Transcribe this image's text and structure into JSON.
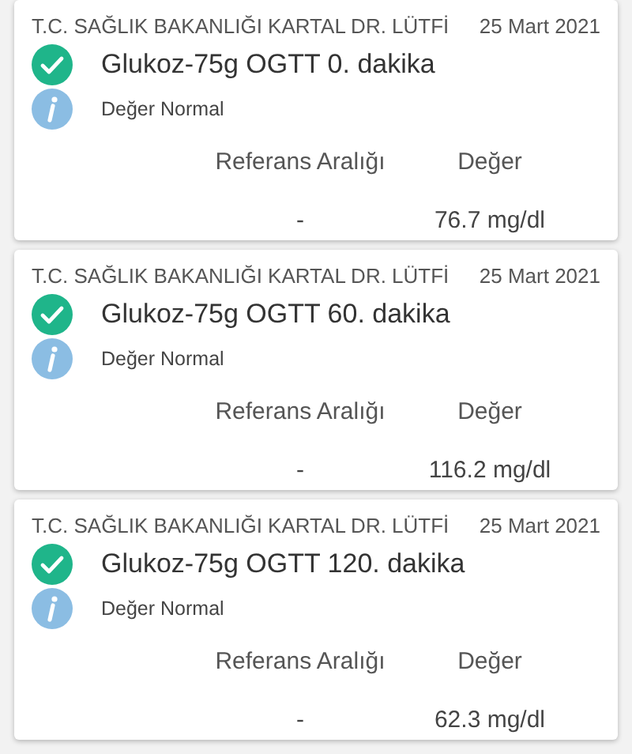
{
  "results": [
    {
      "institution": "T.C. SAĞLIK BAKANLIĞI  KARTAL DR. LÜTFİ",
      "date": "25 Mart 2021",
      "test": "Glukoz-75g OGTT 0. dakika",
      "ok": true,
      "note": "Değer Normal",
      "ref_header": "Referans Aralığı",
      "value_header": "Değer",
      "ref": "-",
      "value": "76.7 mg/dl"
    },
    {
      "institution": "T.C. SAĞLIK BAKANLIĞI  KARTAL DR. LÜTFİ",
      "date": "25 Mart 2021",
      "test": "Glukoz-75g OGTT 60. dakika",
      "ok": true,
      "note": "Değer Normal",
      "ref_header": "Referans Aralığı",
      "value_header": "Değer",
      "ref": "-",
      "value": "116.2 mg/dl"
    },
    {
      "institution": "T.C. SAĞLIK BAKANLIĞI  KARTAL DR. LÜTFİ",
      "date": "25 Mart 2021",
      "test": "Glukoz-75g OGTT 120. dakika",
      "ok": true,
      "note": "Değer Normal",
      "ref_header": "Referans Aralığı",
      "value_header": "Değer",
      "ref": "-",
      "value": "62.3 mg/dl"
    }
  ]
}
